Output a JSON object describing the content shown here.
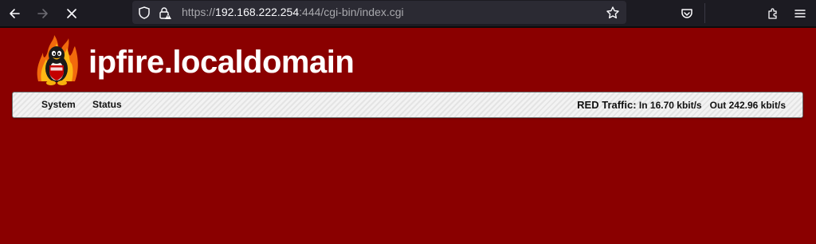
{
  "browser": {
    "url_prefix": "https://",
    "url_host": "192.168.222.254",
    "url_rest": ":444/cgi-bin/index.cgi",
    "icons": [
      "back-arrow-icon",
      "forward-arrow-icon",
      "stop-icon",
      "shield-icon",
      "lock-warning-icon",
      "star-icon",
      "pocket-icon",
      "extensions-icon",
      "menu-icon"
    ]
  },
  "page": {
    "hostname": "ipfire.localdomain",
    "nav": {
      "system": "System",
      "status": "Status"
    },
    "traffic": {
      "label": "RED Traffic:",
      "in": "In 16.70 kbit/s",
      "out": "Out 242.96 kbit/s"
    },
    "colors": {
      "background": "#8a0000",
      "toolbar": "#1c1b22",
      "urlbar": "#2b2a33"
    }
  }
}
